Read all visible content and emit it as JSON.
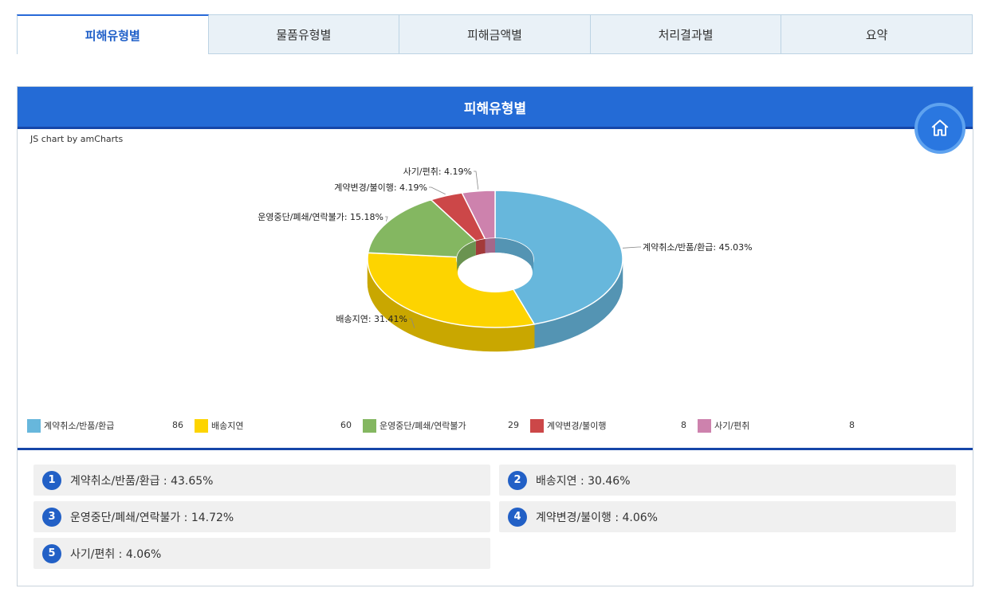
{
  "tabs": [
    {
      "label": "피해유형별",
      "active": true
    },
    {
      "label": "물품유형별",
      "active": false
    },
    {
      "label": "피해금액별",
      "active": false
    },
    {
      "label": "처리결과별",
      "active": false
    },
    {
      "label": "요약",
      "active": false
    }
  ],
  "panel": {
    "title": "피해유형별",
    "credit": "JS chart by amCharts",
    "home_icon": "home-icon"
  },
  "colors": {
    "header": "#246bd6",
    "accent_dark": "#1646a8"
  },
  "chart_data": {
    "type": "pie",
    "style": "3d-donut",
    "categories": [
      "계약취소/반품/환급",
      "배송지연",
      "운영중단/폐쇄/연락불가",
      "계약변경/불이행",
      "사기/편취"
    ],
    "values": [
      86,
      60,
      29,
      8,
      8
    ],
    "percent_labels": [
      "계약취소/반품/환급: 45.03%",
      "배송지연: 31.41%",
      "운영중단/폐쇄/연락불가: 15.18%",
      "계약변경/불이행: 4.19%",
      "사기/편취: 4.19%"
    ],
    "colors": [
      "#67b7dc",
      "#fdd400",
      "#84b761",
      "#cc4748",
      "#cd82ad"
    ],
    "side_colors": [
      "#5494b3",
      "#c9a700",
      "#6a9350",
      "#a33a3a",
      "#a4688a"
    ],
    "legend_position": "bottom"
  },
  "legend": [
    {
      "label": "계약취소/반품/환급",
      "value": "86",
      "color": "#67b7dc"
    },
    {
      "label": "배송지연",
      "value": "60",
      "color": "#fdd400"
    },
    {
      "label": "운영중단/폐쇄/연락불가",
      "value": "29",
      "color": "#84b761"
    },
    {
      "label": "계약변경/불이행",
      "value": "8",
      "color": "#cc4748"
    },
    {
      "label": "사기/편취",
      "value": "8",
      "color": "#cd82ad"
    }
  ],
  "summary": [
    {
      "num": "1",
      "text": "계약취소/반품/환급 : 43.65%"
    },
    {
      "num": "2",
      "text": "배송지연 : 30.46%"
    },
    {
      "num": "3",
      "text": "운영중단/폐쇄/연락불가 : 14.72%"
    },
    {
      "num": "4",
      "text": "계약변경/불이행 : 4.06%"
    },
    {
      "num": "5",
      "text": "사기/편취 : 4.06%"
    }
  ]
}
